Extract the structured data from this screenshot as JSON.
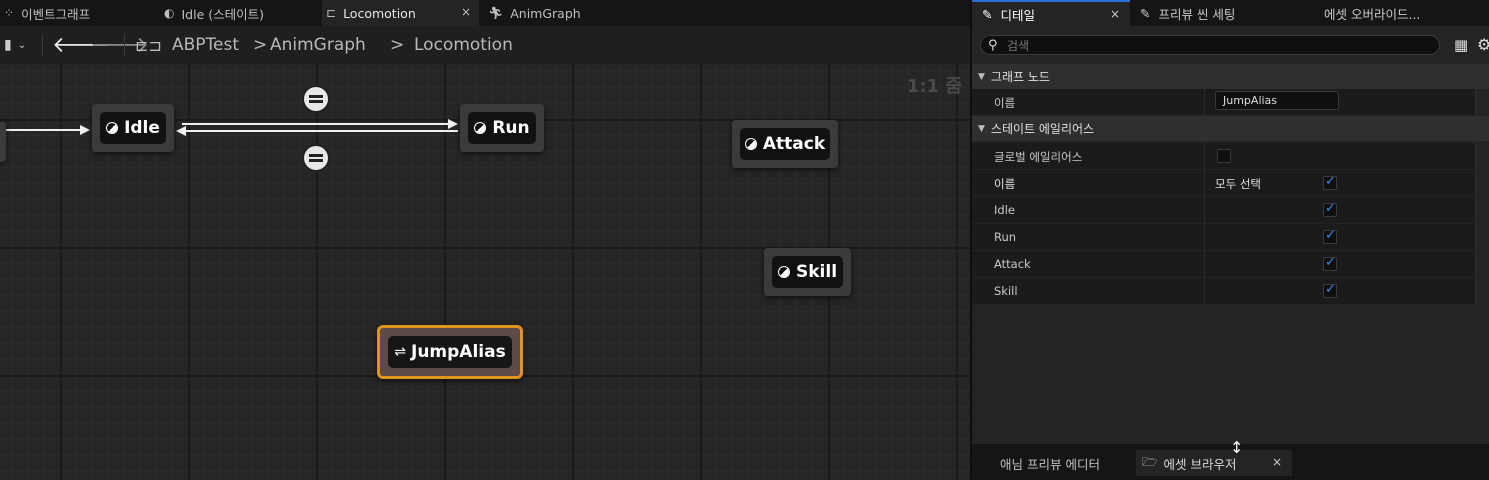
{
  "graph_tabs": [
    {
      "label": "이벤트그래프",
      "icon": "event-graph-icon"
    },
    {
      "label": "Idle (스테이트)",
      "icon": "state-icon"
    },
    {
      "label": "Locomotion",
      "icon": "state-machine-icon",
      "close": "×"
    },
    {
      "label": "AnimGraph",
      "icon": "anim-graph-icon"
    }
  ],
  "toolbar": {
    "breadcrumb": [
      "ABPTest",
      "AnimGraph",
      "Locomotion"
    ],
    "separator": ">",
    "zoom_label": "1:1 줌"
  },
  "graph": {
    "nodes": [
      {
        "label": "Idle",
        "type": "state"
      },
      {
        "label": "Run",
        "type": "state"
      },
      {
        "label": "Attack",
        "type": "state"
      },
      {
        "label": "Skill",
        "type": "state"
      },
      {
        "label": "JumpAlias",
        "type": "state-alias",
        "selected": true
      }
    ]
  },
  "details_tabs": [
    {
      "label": "디테일",
      "close": "×"
    },
    {
      "label": "프리뷰 씬 세팅"
    },
    {
      "label": "에셋 오버라이드..."
    }
  ],
  "details": {
    "search_placeholder": "검색",
    "graph_node_category": "그래프 노드",
    "name_label": "이름",
    "name_value": "JumpAlias",
    "alias_category": "스테이트 에일리어스",
    "global_alias_label": "글로벌 에일리어스",
    "global_alias_checked": false,
    "state_list_label": "이름",
    "select_all_label": "모두 선택",
    "select_all_checked": true,
    "states": [
      {
        "label": "Idle",
        "checked": true
      },
      {
        "label": "Run",
        "checked": true
      },
      {
        "label": "Attack",
        "checked": true
      },
      {
        "label": "Skill",
        "checked": true
      }
    ]
  },
  "bottom_tabs": [
    {
      "label": "애님 프리뷰 에디터"
    },
    {
      "label": "에셋 브라우저",
      "close": "×"
    }
  ],
  "colors": {
    "selection_outline": "#e0951f",
    "checkbox_accent": "#3b8cf5",
    "active_tab_accent": "#2a6fdb"
  }
}
